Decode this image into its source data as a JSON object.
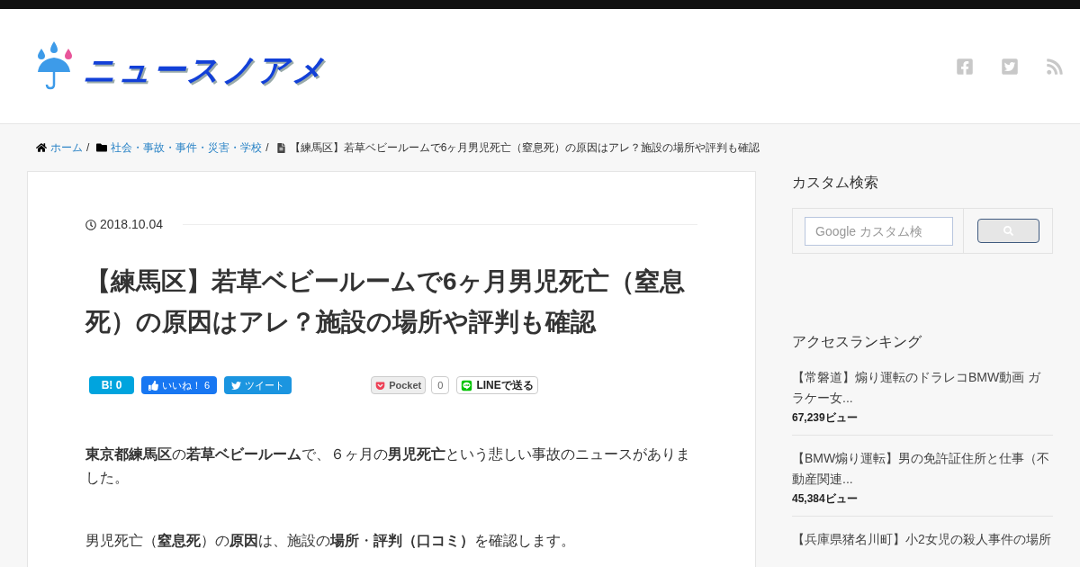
{
  "header": {
    "logo": "ニュースノアメ"
  },
  "breadcrumb": [
    {
      "kind": "home",
      "label": "ホーム",
      "separator": "/"
    },
    {
      "kind": "category",
      "label": "社会・事故・事件・災害・学校",
      "separator": "/"
    },
    {
      "kind": "page",
      "label": "【練馬区】若草ベビールームで6ヶ月男児死亡（窒息死）の原因はアレ？施設の場所や評判も確認"
    }
  ],
  "article": {
    "date": "2018.10.04",
    "title": "【練馬区】若草ベビールームで6ヶ月男児死亡（窒息死）の原因はアレ？施設の場所や評判も確認",
    "share_buttons": [
      {
        "kind": "hatena",
        "label": "B!",
        "count": "0"
      },
      {
        "kind": "facebook",
        "label": "いいね！",
        "count": "6"
      },
      {
        "kind": "twitter",
        "label": "ツイート"
      },
      {
        "kind": "pocket",
        "label": "Pocket",
        "count": "0"
      },
      {
        "kind": "line",
        "label": "LINEで送る"
      }
    ],
    "paragraphs": [
      "**東京都練馬区**の**若草ベビールーム**で、６ヶ月の**男児死亡**という悲しい事故のニュースがありました。",
      "男児死亡（**窒息死**）の**原因**は、施設の**場所**・**評判（口コミ）**を確認します。"
    ]
  },
  "sidebar": {
    "search": {
      "title": "カスタム検索",
      "placeholder": "Google カスタム検"
    },
    "ranking": {
      "title": "アクセスランキング",
      "items": [
        {
          "title": "【常磐道】煽り運転のドラレコBMW動画 ガラケー女...",
          "views": "67,239ビュー"
        },
        {
          "title": "【BMW煽り運転】男の免許証住所と仕事（不動産関連...",
          "views": "45,384ビュー"
        },
        {
          "title": "【兵庫県猪名川町】小2女児の殺人事件の場所"
        }
      ]
    }
  }
}
